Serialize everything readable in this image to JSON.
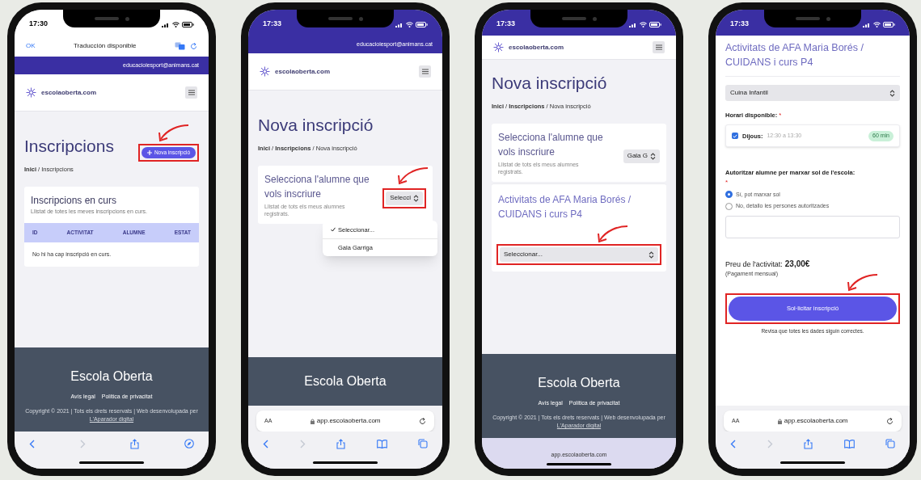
{
  "screens": [
    {
      "status_time": "17:30",
      "translate_bar": {
        "done": "OK",
        "title": "Traducción disponible"
      },
      "account": "educacioiesport@animans.cat",
      "site_name": "escolaoberta.com",
      "page_title": "Inscripcions",
      "new_button": "Nova inscripció",
      "breadcrumb": "**Inici** / Inscripcions",
      "card": {
        "title": "Inscripcions en curs",
        "subtitle": "Llistat de totes les meves inscripcions en curs.",
        "columns": [
          "ID",
          "ACTIVITAT",
          "ALUMNE",
          "ESTAT"
        ],
        "empty_message": "No hi ha cap inscripció en curs."
      },
      "footer": {
        "brand": "Escola Oberta",
        "links": [
          "Avís legal",
          "Política de privacitat"
        ],
        "copyright": "Copyright © 2021 | Tots els drets reservats | Web desenvolupada per",
        "credit": "L'Aparador digital"
      }
    },
    {
      "status_time": "17:33",
      "account": "educacioiesport@animans.cat",
      "site_name": "escolaoberta.com",
      "page_title": "Nova inscripció",
      "breadcrumb": "**Inici** / **Inscripcions** / Nova inscripció",
      "student_card": {
        "title": "Selecciona l'alumne que vols inscriure",
        "hint": "Llistat de tots els meus alumnes registrats.",
        "select_value": "Selecci"
      },
      "dropdown": [
        {
          "label": "Seleccionar...",
          "selected": true
        },
        {
          "label": "Gala Garriga",
          "selected": false
        }
      ],
      "footer": {
        "brand": "Escola Oberta"
      },
      "address_bar": {
        "text_size": "AA",
        "url": "app.escolaoberta.com"
      }
    },
    {
      "status_time": "17:33",
      "site_name": "escolaoberta.com",
      "page_title": "Nova inscripció",
      "breadcrumb": "**Inici** / **Inscripcions** / Nova inscripció",
      "student_card": {
        "title": "Selecciona l'alumne que vols inscriure",
        "hint": "Llistat de tots els meus alumnes registrats.",
        "select_value": "Gala G"
      },
      "activity_card": {
        "title": "Activitats de AFA Maria Borés / CUIDANS i curs P4",
        "select_value": "Seleccionar..."
      },
      "footer": {
        "brand": "Escola Oberta",
        "links": [
          "Avís legal",
          "Política de privacitat"
        ],
        "copyright": "Copyright © 2021 | Tots els drets reservats | Web desenvolupada per",
        "credit": "L'Aparador digital"
      },
      "address_bar": {
        "url": "app.escolaoberta.com"
      }
    },
    {
      "status_time": "17:33",
      "activity_heading": "Activitats de AFA Maria Borés / CUIDANS i curs P4",
      "activity_select": "Cuina Infantil",
      "schedule": {
        "label": "Horari disponible:",
        "required": "*",
        "slots": [
          {
            "checked": true,
            "day": "Dijous:",
            "time": "12:30 a 13:30",
            "badge": "60 min"
          }
        ]
      },
      "pickup": {
        "label": "Autoritzar alumne per marxar sol de l'escola:",
        "required": "*",
        "options": [
          {
            "label": "Sí, pot marxar sol",
            "selected": true
          },
          {
            "label": "No, detallo les persones autoritzades",
            "selected": false
          }
        ]
      },
      "price": {
        "label": "Preu de l'activitat:",
        "value": "23,00€",
        "note": "(Pagament mensual)"
      },
      "submit_button": "Sol·licitar inscripció",
      "submit_note": "Revisa que totes les dades siguin correctes.",
      "address_bar": {
        "text_size": "AA",
        "url": "app.escolaoberta.com"
      }
    }
  ]
}
